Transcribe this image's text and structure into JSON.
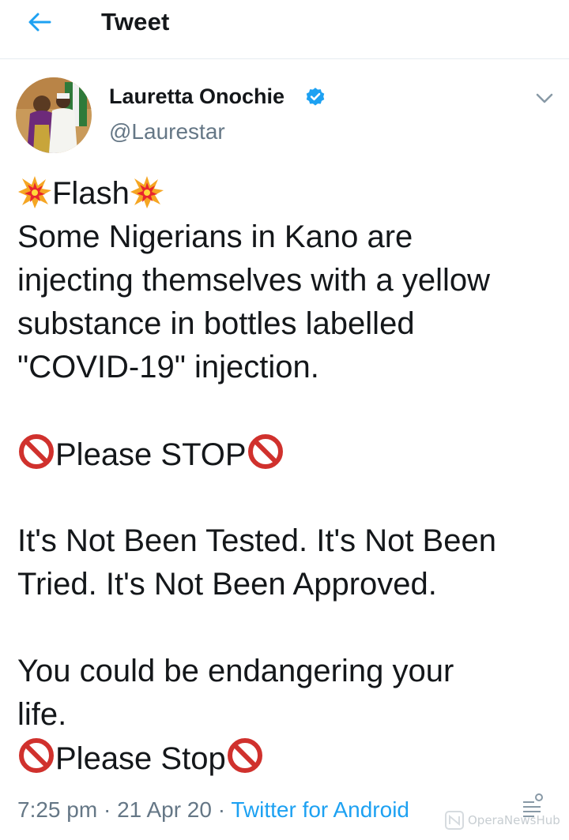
{
  "header": {
    "title": "Tweet",
    "back_icon": "arrow-left-icon"
  },
  "colors": {
    "accent": "#1da1f2",
    "text": "#14171a",
    "muted": "#657786",
    "divider": "#e6ecf0",
    "verified": "#1da1f2",
    "prohibited": "#d0312d"
  },
  "author": {
    "name": "Lauretta Onochie",
    "handle": "@Laurestar",
    "verified": true
  },
  "tweet": {
    "flash_word": "Flash",
    "lines": [
      "Some Nigerians in Kano are",
      "injecting themselves with a yellow",
      "substance in bottles labelled",
      "\"COVID-19\" injection."
    ],
    "please_stop_upper": "Please STOP",
    "tested_lines": [
      "It's Not Been Tested. It's Not Been",
      "Tried. It's Not Been Approved."
    ],
    "danger_lines": [
      "You could be endangering your",
      "life."
    ],
    "please_stop_lower": "Please Stop"
  },
  "meta": {
    "time": "7:25 pm",
    "separator": " · ",
    "date": "21 Apr 20",
    "source": "Twitter for Android"
  },
  "watermark": {
    "text": "OperaNewsHub"
  }
}
